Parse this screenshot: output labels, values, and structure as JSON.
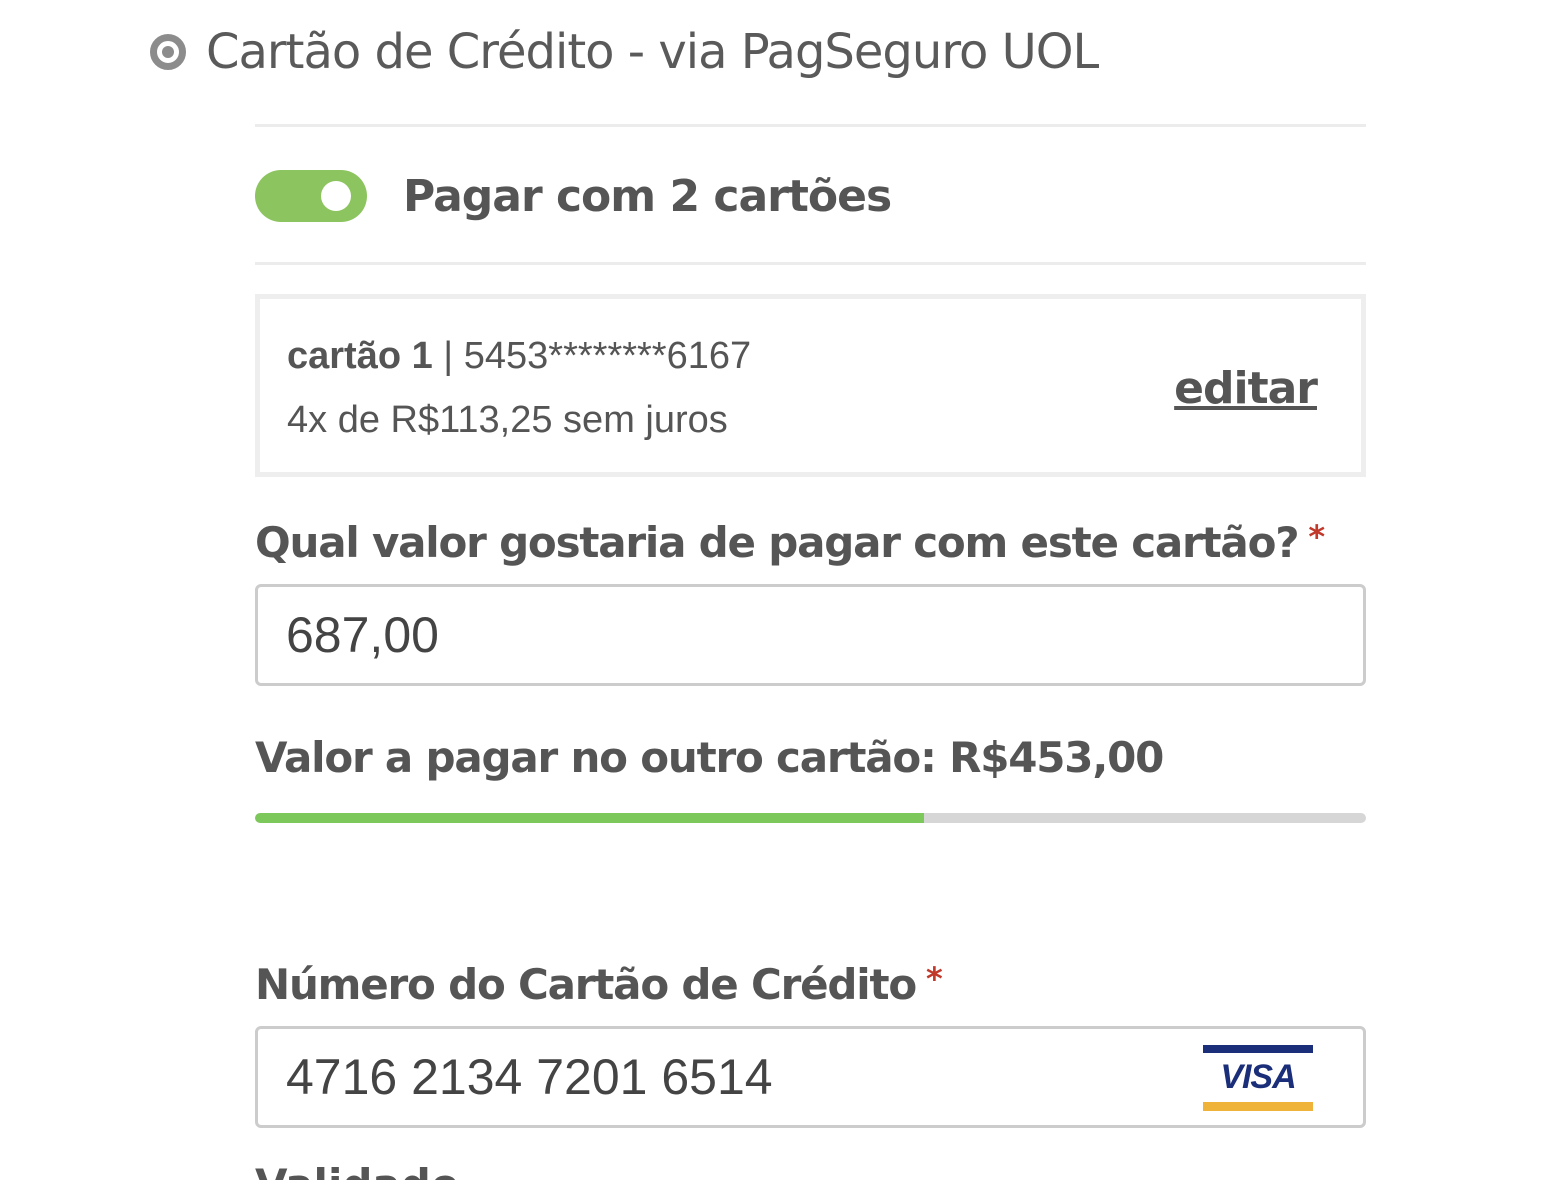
{
  "payment_method": {
    "label": "Cartão de Crédito - via PagSeguro UOL",
    "selected": true
  },
  "split_toggle": {
    "label": "Pagar com 2 cartões",
    "on": true,
    "color": "#8cc460"
  },
  "card_summary": {
    "title": "cartão 1",
    "separator": " | ",
    "masked_number": "5453********6167",
    "installments": "4x de R$113,25 sem juros",
    "edit_label": "editar"
  },
  "amount_field": {
    "label": "Qual valor gostaria de pagar com este cartão?",
    "required_mark": "*",
    "value": "687,00"
  },
  "remaining": {
    "text": "Valor a pagar no outro cartão: R$453,00",
    "progress_fraction": 0.6026,
    "fill_color": "#7cc85a"
  },
  "card_number_field": {
    "label": "Número do Cartão de Crédito",
    "required_mark": "*",
    "value": "4716  2134 7201 6514",
    "brand": "VISA",
    "brand_icon": "visa-logo-icon"
  },
  "next_field": {
    "label": "Validade"
  }
}
